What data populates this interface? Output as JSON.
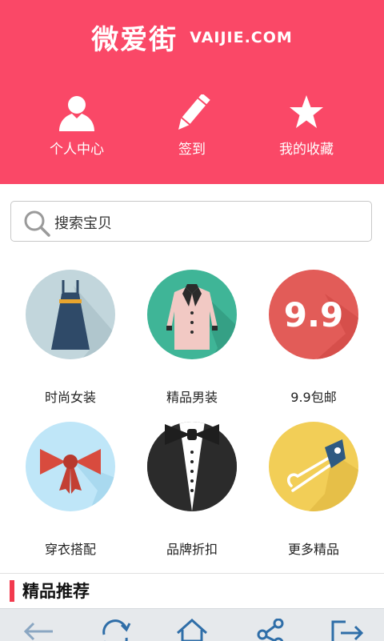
{
  "header": {
    "logo_cn": "微爱街",
    "logo_en": "VAIJIE.COM",
    "nav": [
      {
        "label": "个人中心",
        "icon": "person-icon"
      },
      {
        "label": "签到",
        "icon": "pencil-icon"
      },
      {
        "label": "我的收藏",
        "icon": "star-icon"
      }
    ],
    "bg_color": "#fa4867"
  },
  "search": {
    "placeholder": "搜索宝贝",
    "icon": "search-icon"
  },
  "categories": [
    {
      "label": "时尚女装",
      "icon": "dress-icon",
      "color": "#c2d6dc"
    },
    {
      "label": "精品男装",
      "icon": "jacket-icon",
      "color": "#3fb597"
    },
    {
      "label": "9.9包邮",
      "icon": "nine-nine-icon",
      "color": "#e25c58",
      "badge": "9.9"
    },
    {
      "label": "穿衣搭配",
      "icon": "bow-icon",
      "color": "#bfe6f8"
    },
    {
      "label": "品牌折扣",
      "icon": "tuxedo-icon",
      "color": "#2b2b2b"
    },
    {
      "label": "更多精品",
      "icon": "safety-pin-icon",
      "color": "#f2ce57"
    }
  ],
  "section": {
    "title": "精品推荐",
    "accent": "#f23a4e"
  },
  "bottom_bar": [
    {
      "icon": "back-arrow-icon"
    },
    {
      "icon": "refresh-icon"
    },
    {
      "icon": "home-icon"
    },
    {
      "icon": "share-icon"
    },
    {
      "icon": "exit-icon"
    }
  ]
}
